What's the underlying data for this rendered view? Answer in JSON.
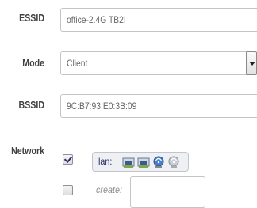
{
  "form": {
    "essid": {
      "label": "ESSID",
      "value": "office-2.4G TB2I"
    },
    "mode": {
      "label": "Mode",
      "selected": "Client"
    },
    "bssid": {
      "label": "BSSID",
      "value": "9C:B7:93:E0:3B:09"
    },
    "network": {
      "label": "Network",
      "lan": {
        "checked": true,
        "name": "lan:",
        "icons": [
          "ethernet-port-icon",
          "ethernet-port-icon",
          "wifi-icon",
          "wifi-icon"
        ]
      },
      "create": {
        "checked": false,
        "label": "create:",
        "value": ""
      }
    }
  }
}
